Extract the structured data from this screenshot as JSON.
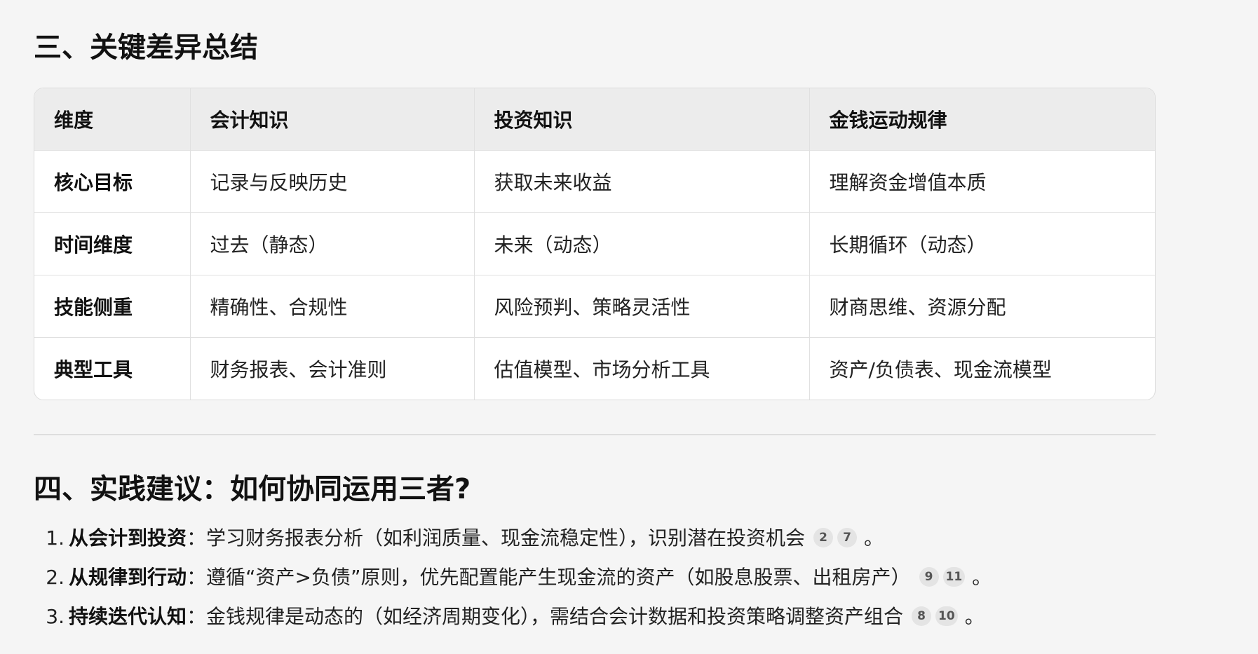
{
  "section3": {
    "title": "三、关键差异总结"
  },
  "table": {
    "headers": [
      "维度",
      "会计知识",
      "投资知识",
      "金钱运动规律"
    ],
    "rows": [
      [
        "核心目标",
        "记录与反映历史",
        "获取未来收益",
        "理解资金增值本质"
      ],
      [
        "时间维度",
        "过去（静态）",
        "未来（动态）",
        "长期循环（动态）"
      ],
      [
        "技能侧重",
        "精确性、合规性",
        "风险预判、策略灵活性",
        "财商思维、资源分配"
      ],
      [
        "典型工具",
        "财务报表、会计准则",
        "估值模型、市场分析工具",
        "资产/负债表、现金流模型"
      ]
    ]
  },
  "section4": {
    "title": "四、实践建议：如何协同运用三者?",
    "items": [
      {
        "number": "1.",
        "title": "从会计到投资",
        "text": "：学习财务报表分析（如利润质量、现金流稳定性），识别潜在投资机会",
        "citations": [
          "2",
          "7"
        ],
        "end": "。"
      },
      {
        "number": "2.",
        "title": "从规律到行动",
        "text": "：遵循“资产>负债”原则，优先配置能产生现金流的资产（如股息股票、出租房产）",
        "citations": [
          "9",
          "11"
        ],
        "end": "。"
      },
      {
        "number": "3.",
        "title": "持续迭代认知",
        "text": "：金钱规律是动态的（如经济周期变化），需结合会计数据和投资策略调整资产组合",
        "citations": [
          "8",
          "10"
        ],
        "end": "。"
      }
    ]
  }
}
